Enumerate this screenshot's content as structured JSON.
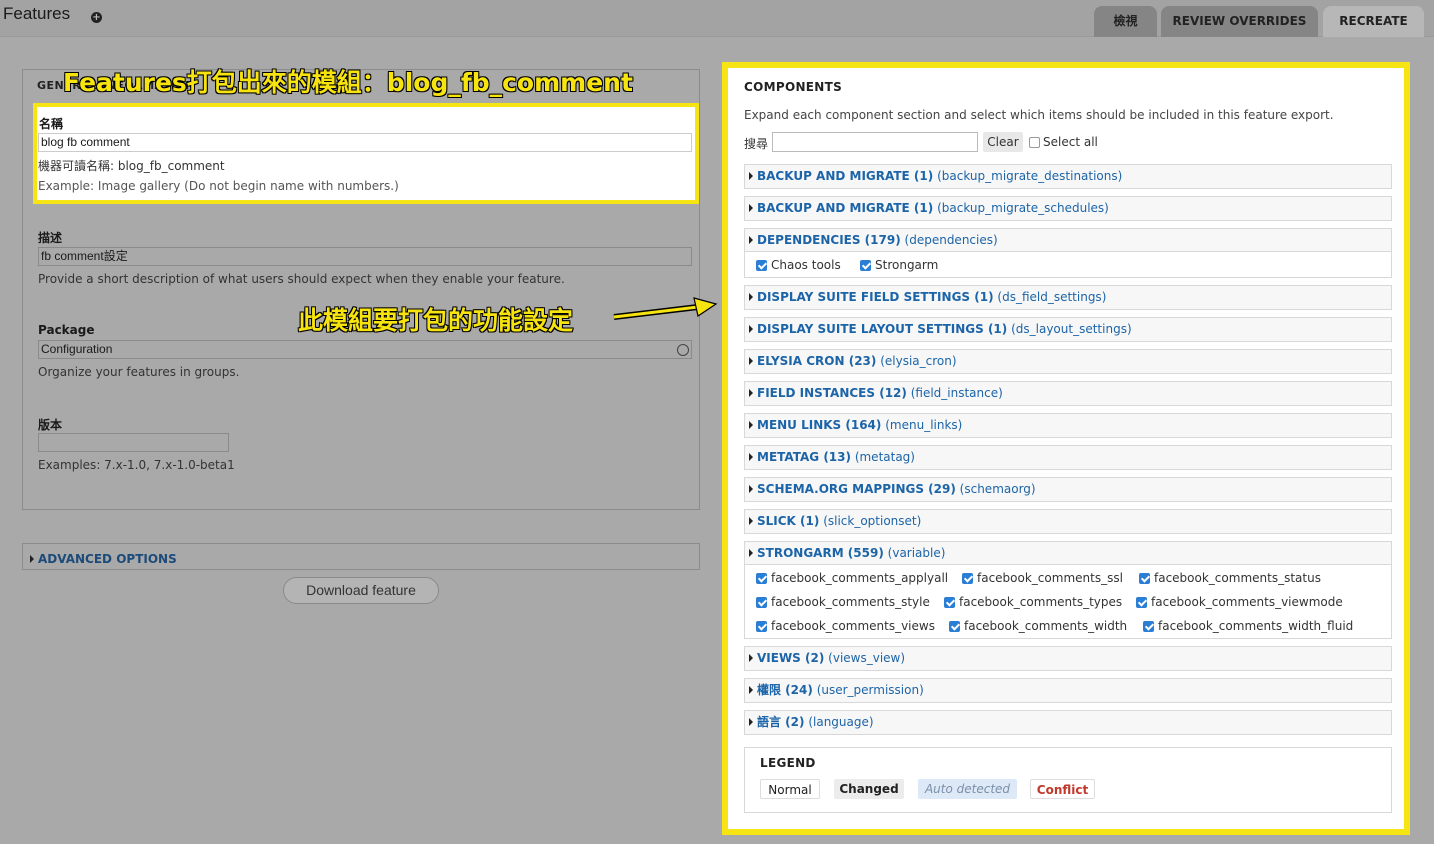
{
  "header": {
    "title": "Features",
    "tabs": [
      "檢視",
      "REVIEW OVERRIDES",
      "RECREATE"
    ]
  },
  "general": {
    "legend": "GENERAL INFORMATION",
    "name_label": "名稱",
    "name_value": "blog fb comment",
    "machine_name": "機器可讀名稱: blog_fb_comment",
    "name_help": "Example: Image gallery (Do not begin name with numbers.)",
    "desc_label": "描述",
    "desc_value": "fb comment設定",
    "desc_help": "Provide a short description of what users should expect when they enable your feature.",
    "package_label": "Package",
    "package_value": "Configuration",
    "package_help": "Organize your features in groups.",
    "version_label": "版本",
    "version_value": "",
    "version_help": "Examples: 7.x-1.0, 7.x-1.0-beta1"
  },
  "advanced": {
    "label": "ADVANCED OPTIONS"
  },
  "download_button": "Download feature",
  "callouts": {
    "module": "Features打包出來的模組：blog_fb_comment",
    "functions": "此模組要打包的功能設定"
  },
  "components": {
    "title": "COMPONENTS",
    "description": "Expand each component section and select which items should be included in this feature export.",
    "search_label": "搜尋",
    "clear_label": "Clear",
    "select_all_label": "Select all",
    "sections": [
      {
        "name": "BACKUP AND MIGRATE (1)",
        "key": "(backup_migrate_destinations)"
      },
      {
        "name": "BACKUP AND MIGRATE (1)",
        "key": "(backup_migrate_schedules)"
      },
      {
        "name": "DEPENDENCIES (179)",
        "key": "(dependencies)"
      },
      {
        "name": "DISPLAY SUITE FIELD SETTINGS (1)",
        "key": "(ds_field_settings)"
      },
      {
        "name": "DISPLAY SUITE LAYOUT SETTINGS (1)",
        "key": "(ds_layout_settings)"
      },
      {
        "name": "ELYSIA CRON (23)",
        "key": "(elysia_cron)"
      },
      {
        "name": "FIELD INSTANCES (12)",
        "key": "(field_instance)"
      },
      {
        "name": "MENU LINKS (164)",
        "key": "(menu_links)"
      },
      {
        "name": "METATAG (13)",
        "key": "(metatag)"
      },
      {
        "name": "SCHEMA.ORG MAPPINGS (29)",
        "key": "(schemaorg)"
      },
      {
        "name": "SLICK (1)",
        "key": "(slick_optionset)"
      },
      {
        "name": "STRONGARM (559)",
        "key": "(variable)"
      },
      {
        "name": "VIEWS (2)",
        "key": "(views_view)"
      },
      {
        "name": "權限 (24)",
        "key": "(user_permission)"
      },
      {
        "name": "語言 (2)",
        "key": "(language)"
      }
    ],
    "dependencies_items": [
      "Chaos tools",
      "Strongarm"
    ],
    "strongarm_items": [
      "facebook_comments_applyall",
      "facebook_comments_ssl",
      "facebook_comments_status",
      "facebook_comments_style",
      "facebook_comments_types",
      "facebook_comments_viewmode",
      "facebook_comments_views",
      "facebook_comments_width",
      "facebook_comments_width_fluid"
    ]
  },
  "legend": {
    "title": "LEGEND",
    "normal": "Normal",
    "changed": "Changed",
    "auto": "Auto detected",
    "conflict": "Conflict"
  }
}
